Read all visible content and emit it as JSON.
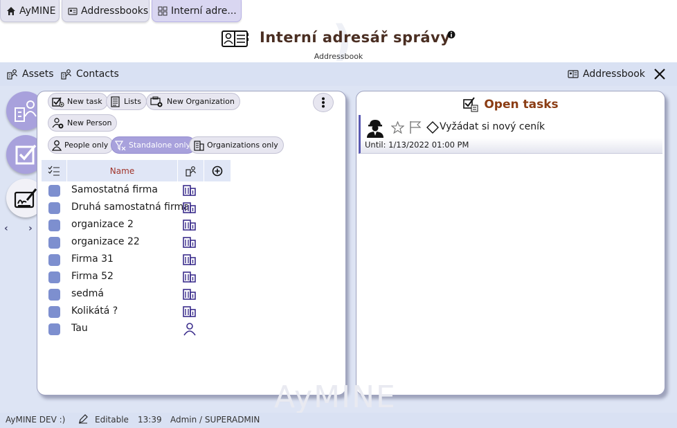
{
  "tabs": [
    {
      "label": "AyMINE",
      "icon": "home-icon"
    },
    {
      "label": "Addressbooks",
      "icon": "addressbook-icon"
    },
    {
      "label": "Interní adre...",
      "icon": "grid-icon"
    }
  ],
  "header": {
    "title": "Interní adresář správy",
    "subtitle": "Addressbook"
  },
  "nav": {
    "assets": "Assets",
    "contacts": "Contacts",
    "addressbook": "Addressbook"
  },
  "toolbar": {
    "new_task": "New task",
    "lists": "Lists",
    "new_organization": "New Organization",
    "new_person": "New Person"
  },
  "filters": {
    "people_only": "People only",
    "standalone_only": "Standalone only",
    "organizations_only": "Organizations only"
  },
  "grid": {
    "name_header": "Name",
    "rows": [
      {
        "name": "Samostatná firma",
        "type": "organization"
      },
      {
        "name": "Druhá samostatná firma",
        "type": "organization"
      },
      {
        "name": "organizace 2",
        "type": "organization"
      },
      {
        "name": "organizace 22",
        "type": "organization"
      },
      {
        "name": "Firma 31",
        "type": "organization"
      },
      {
        "name": "Firma 52",
        "type": "organization"
      },
      {
        "name": "sedmá",
        "type": "organization"
      },
      {
        "name": "Kolikátá ?",
        "type": "organization"
      },
      {
        "name": "Tau",
        "type": "person"
      }
    ]
  },
  "tasks": {
    "title": "Open tasks",
    "items": [
      {
        "title": "Vyžádat si nový ceník",
        "until": "Until: 1/13/2022 01:00 PM"
      }
    ]
  },
  "watermark": "AyMINE",
  "status": {
    "env": "AyMINE DEV :)",
    "mode": "Editable",
    "time": "13:39",
    "user": "Admin / SUPERADMIN"
  },
  "colors": {
    "accent": "#a8a1dc",
    "title": "#4a2e22",
    "tasks_title": "#8b3d14",
    "navbar": "#d9e1f3",
    "checkbox": "#7d8fcf",
    "icon": "#3b2d8c"
  }
}
